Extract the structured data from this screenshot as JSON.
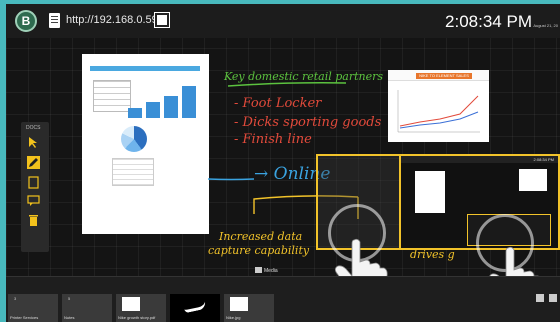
{
  "app": {
    "url": "http://192.168.0.59",
    "logo_letter": "B"
  },
  "clock": {
    "time": "2:08:34 PM",
    "date": "August 21, 20"
  },
  "palette": {
    "label": "DOCS",
    "tools": [
      "select-icon",
      "pen-icon",
      "document-icon",
      "comment-icon",
      "trash-icon"
    ],
    "active_tool": "pen-icon",
    "active_color": "#f3c21c"
  },
  "canvas": {
    "notes": {
      "heading": "Key domestic retail partners",
      "partners": [
        "- Foot Locker",
        "- Dicks sporting goods",
        "- Finish line"
      ],
      "online": "→ Online",
      "capture_line1": "Increased data",
      "capture_line2": "capture capability",
      "drives": "drives g"
    },
    "colors": {
      "green": "#5cc23f",
      "red": "#e24a3b",
      "blue": "#3aa3e0",
      "yellow": "#f2c32a"
    },
    "slide": {
      "title": "NIKE TO ELEMENT SALES"
    },
    "window": {
      "time": "2:08:34 PM"
    }
  },
  "media": {
    "label": "Media"
  },
  "taskbar": {
    "items": [
      {
        "count": "3",
        "label": "Printer Services"
      },
      {
        "count": "5",
        "label": "Nutes"
      },
      {
        "count": "",
        "label": "Nike growth story.pdf"
      },
      {
        "count": "",
        "label": ""
      },
      {
        "count": "",
        "label": "Nike.jpg"
      },
      {
        "count": "",
        "label": "Nike.ppt"
      }
    ]
  }
}
